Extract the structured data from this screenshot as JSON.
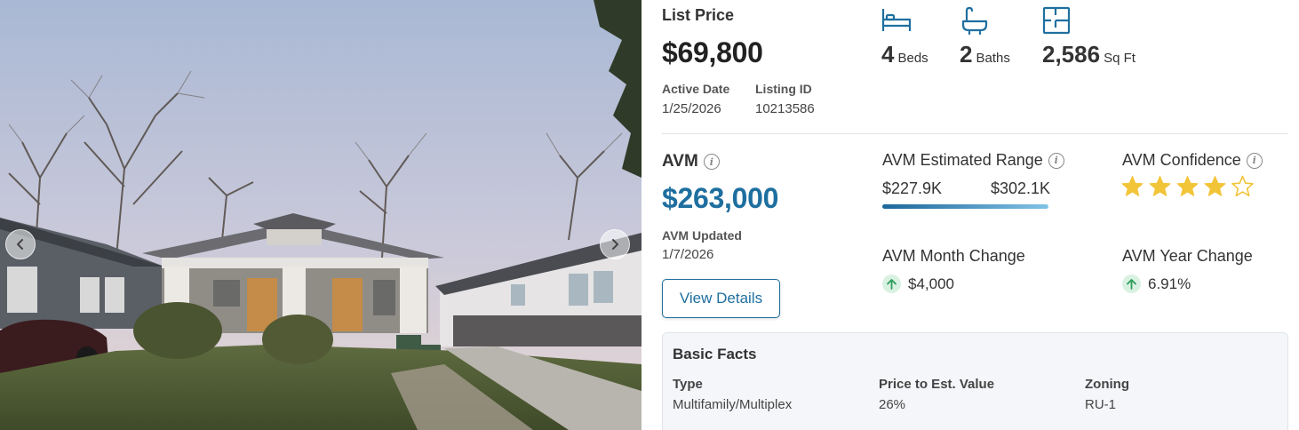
{
  "gallery": {
    "prev_icon": "chevron-left-icon",
    "next_icon": "chevron-right-icon"
  },
  "listing": {
    "list_price_label": "List Price",
    "list_price": "$69,800",
    "active_date_label": "Active Date",
    "active_date": "1/25/2026",
    "listing_id_label": "Listing ID",
    "listing_id": "10213586"
  },
  "specs": [
    {
      "icon": "bed-icon",
      "value": "4",
      "unit": "Beds"
    },
    {
      "icon": "bathtub-icon",
      "value": "2",
      "unit": "Baths"
    },
    {
      "icon": "floorplan-icon",
      "value": "2,586",
      "unit": "Sq Ft"
    }
  ],
  "avm": {
    "title": "AVM",
    "value": "$263,000",
    "updated_label": "AVM Updated",
    "updated": "1/7/2026",
    "view_details": "View Details",
    "range_title": "AVM Estimated Range",
    "range_low": "$227.9K",
    "range_high": "$302.1K",
    "confidence_title": "AVM Confidence",
    "confidence_stars": 4,
    "confidence_max": 5,
    "month_change_title": "AVM Month Change",
    "month_change": "$4,000",
    "year_change_title": "AVM Year Change",
    "year_change": "6.91%"
  },
  "basic_facts": {
    "title": "Basic Facts",
    "items": [
      {
        "label": "Type",
        "value": "Multifamily/Multiplex"
      },
      {
        "label": "Price to Est. Value",
        "value": "26%"
      },
      {
        "label": "Zoning",
        "value": "RU-1"
      }
    ]
  },
  "colors": {
    "accent": "#1e6f9f",
    "star": "#f2c438",
    "up_bg": "#d9f1e2",
    "up_arrow": "#2e9e5b"
  }
}
